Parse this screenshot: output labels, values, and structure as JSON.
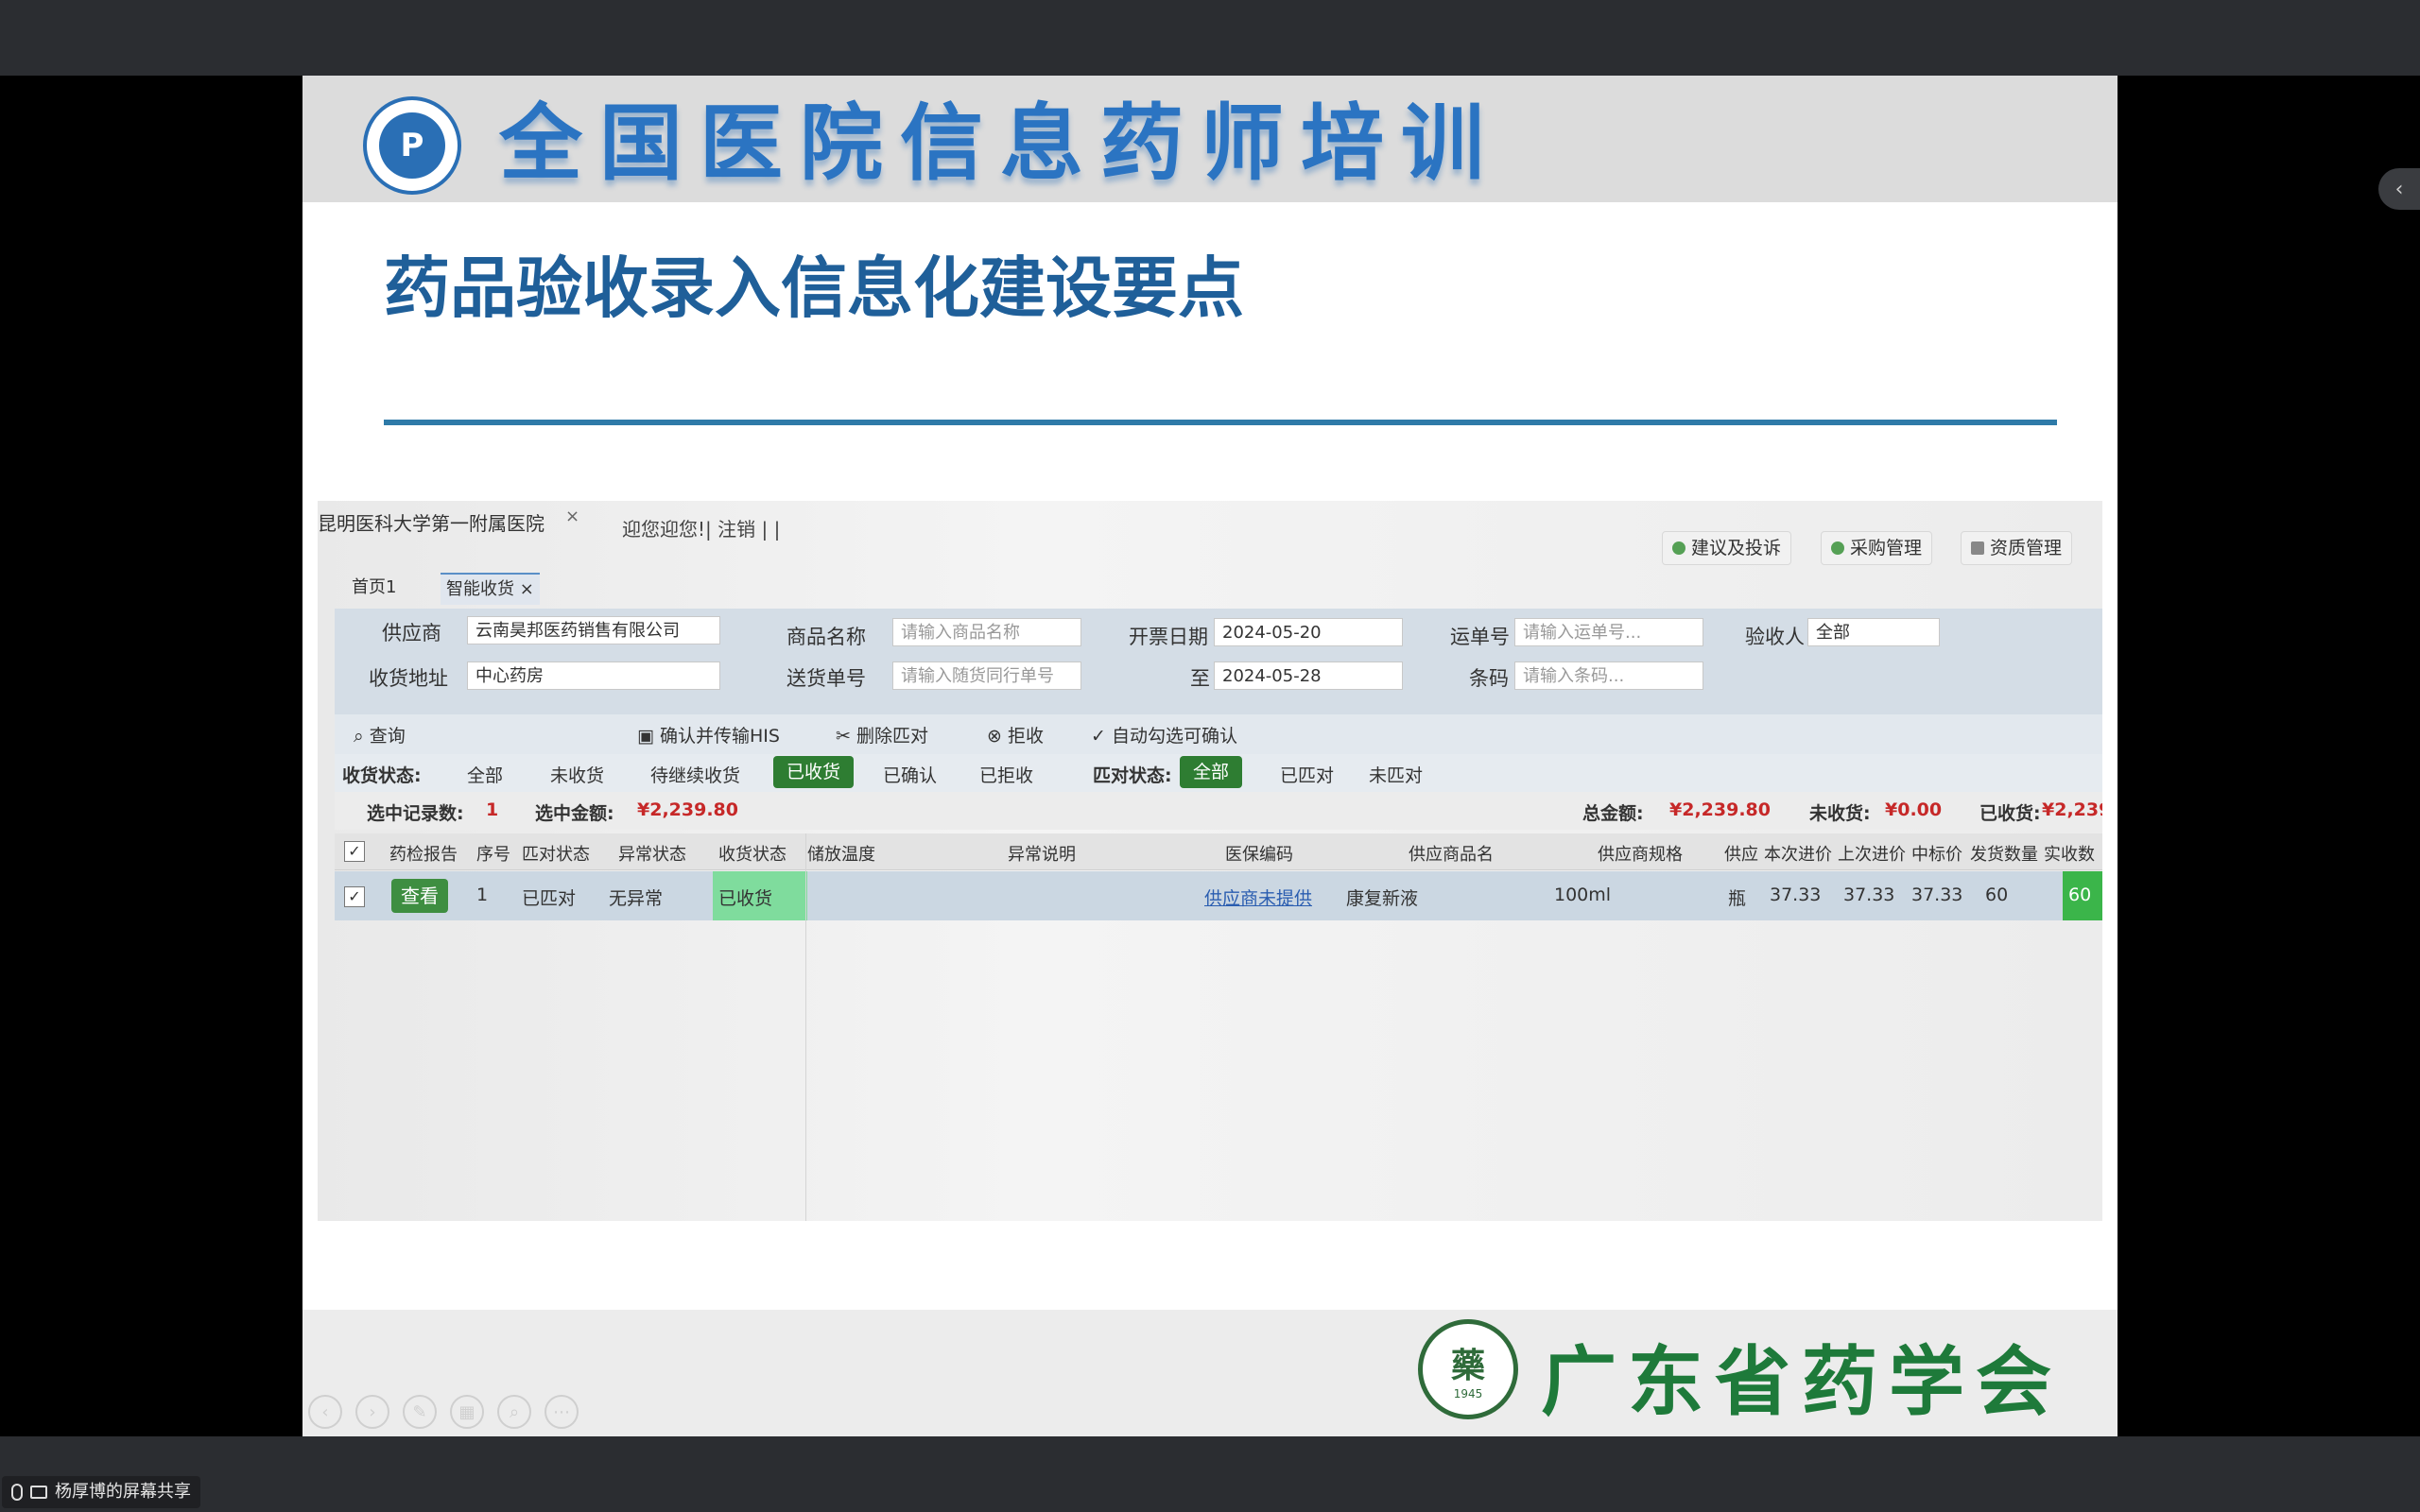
{
  "slide": {
    "org_title": "全国医院信息药师培训",
    "title": "药品验收录入信息化建设要点",
    "footer_org": "广东省药学会",
    "seal_glyph": "藥",
    "seal_year": "1945"
  },
  "system": {
    "hospital_tab": "昆明医科大学第一附属医院",
    "tab_close": "×",
    "welcome": "迎您迎您!| 注销 | |",
    "top_buttons": [
      "建议及投诉",
      "采购管理",
      "资质管理"
    ],
    "subtabs": [
      "首页1",
      "智能收货"
    ],
    "filters": {
      "supplier_label": "供应商",
      "supplier_value": "云南昊邦医药销售有限公司",
      "address_label": "收货地址",
      "address_value": "中心药房",
      "product_label": "商品名称",
      "product_placeholder": "请输入商品名称",
      "delivery_label": "送货单号",
      "delivery_placeholder": "请输入随货同行单号",
      "invoice_date_label": "开票日期",
      "date_from": "2024-05-20",
      "to_label": "至",
      "date_to": "2024-05-28",
      "waybill_label": "运单号",
      "waybill_placeholder": "请输入运单号...",
      "barcode_label": "条码",
      "barcode_placeholder": "请输入条码...",
      "inspector_label": "验收人",
      "inspector_value": "全部"
    },
    "toolbar": {
      "query": "查询",
      "confirm_his": "确认并传输HIS",
      "delete_match": "删除匹对",
      "reject": "拒收",
      "auto_check": "自动勾选可确认"
    },
    "status": {
      "label": "收货状态:",
      "options": [
        "全部",
        "未收货",
        "待继续收货",
        "已收货",
        "已确认",
        "已拒收"
      ],
      "active": "已收货",
      "match_label": "匹对状态:",
      "match_options": [
        "全部",
        "已匹对",
        "未匹对"
      ],
      "match_active": "全部"
    },
    "summary": {
      "selected_count_label": "选中记录数:",
      "selected_count": "1",
      "selected_amount_label": "选中金额:",
      "selected_amount": "¥2,239.80",
      "total_label": "总金额:",
      "total": "¥2,239.80",
      "unreceived_label": "未收货:",
      "unreceived": "¥0.00",
      "received_label": "已收货:",
      "received": "¥2,239."
    },
    "columns": [
      "药检报告",
      "序号",
      "匹对状态",
      "异常状态",
      "收货状态",
      "储放温度",
      "异常说明",
      "医保编码",
      "供应商品名",
      "供应商规格",
      "供应",
      "本次进价",
      "上次进价",
      "中标价",
      "发货数量",
      "实收数"
    ],
    "row": {
      "view": "查看",
      "seq": "1",
      "match": "已匹对",
      "abnormal": "无异常",
      "recv_status": "已收货",
      "insurance_code": "供应商未提供",
      "product_name": "康复新液",
      "spec": "100ml",
      "unit": "瓶",
      "price_now": "37.33",
      "price_last": "37.33",
      "bid_price": "37.33",
      "ship_qty": "60",
      "recv_qty": "60"
    }
  },
  "share": {
    "label": "杨厚博的屏幕共享"
  },
  "colors": {
    "title_blue": "#1f5f99",
    "accent_green": "#2e7d32",
    "amount_red": "#c62828"
  }
}
